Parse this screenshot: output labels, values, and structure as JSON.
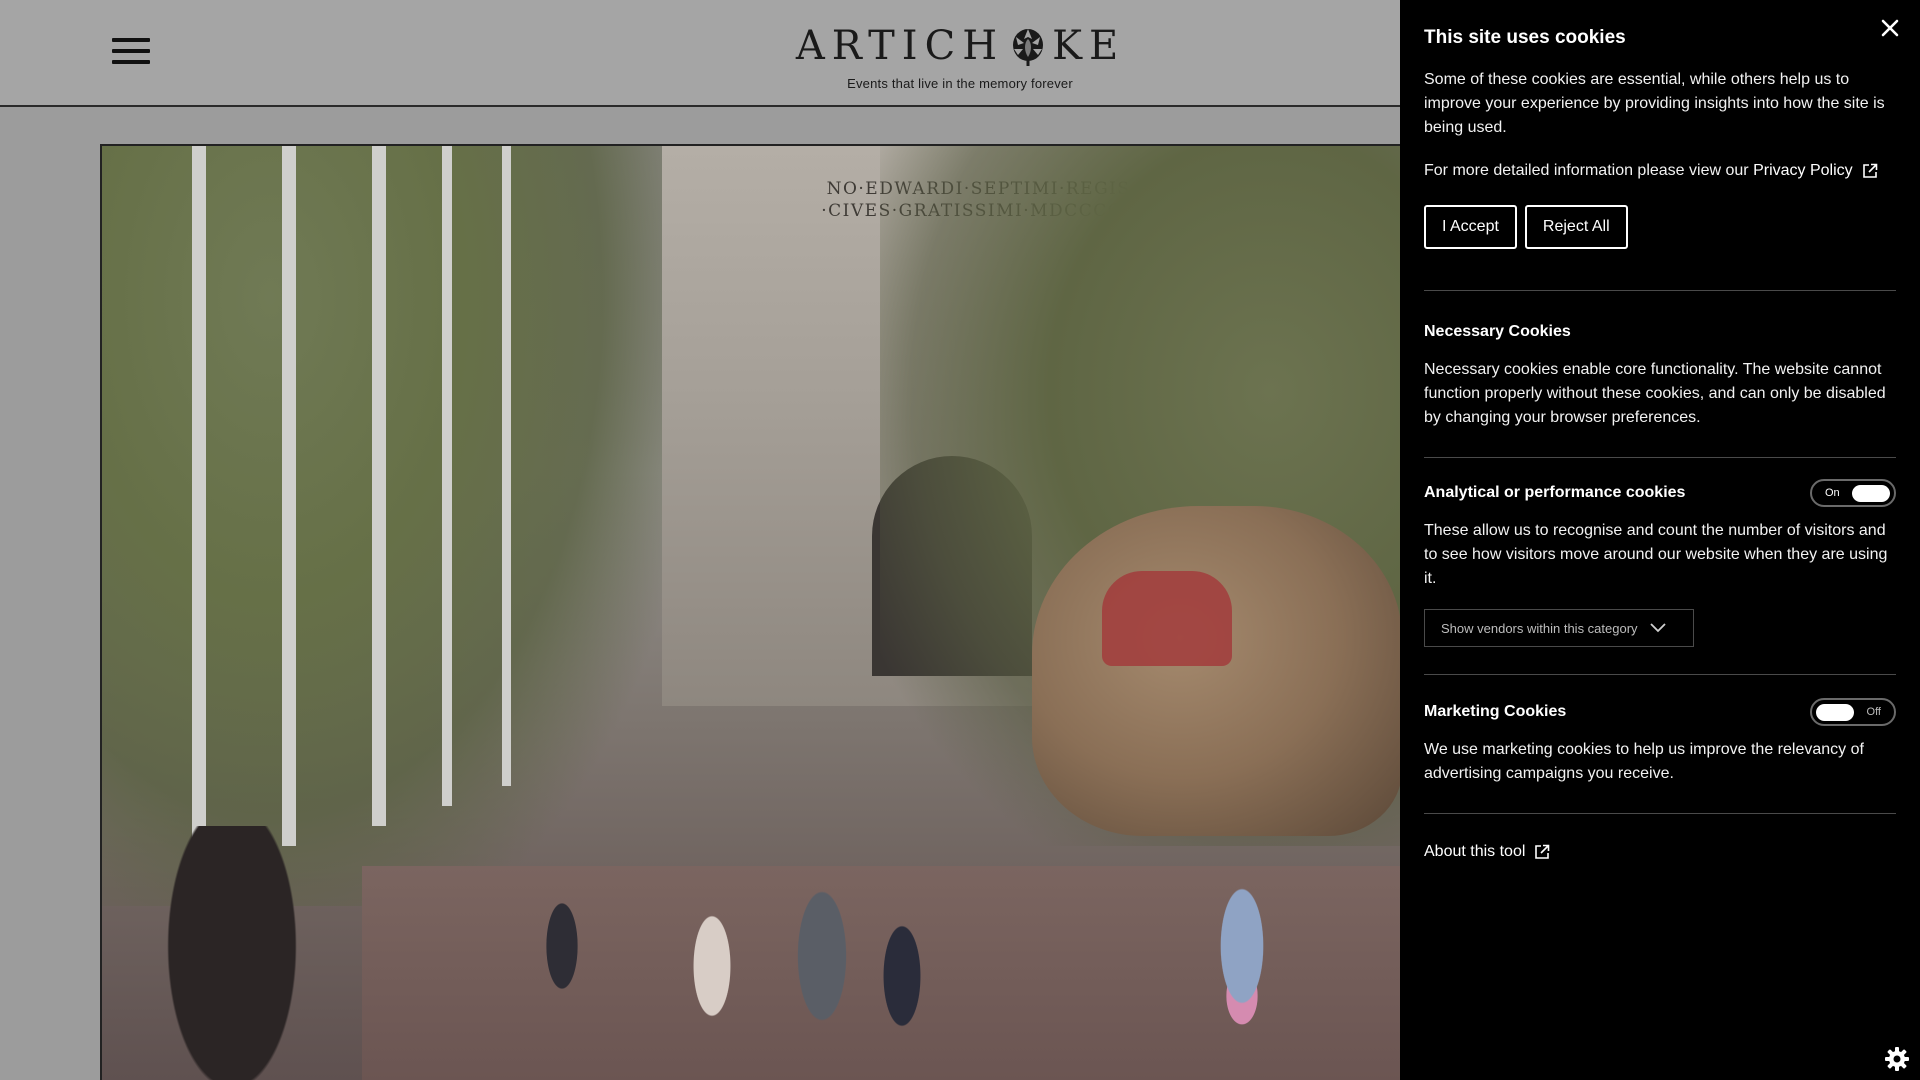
{
  "header": {
    "logo_left": "ARTICH",
    "logo_right": "KE",
    "tagline": "Events that live in the memory forever",
    "menu_icon": "hamburger-menu-icon"
  },
  "hero": {
    "inscription_line1": "NO·EDWARDI·SEPTIMI·REGIS·",
    "inscription_line2": "·CIVES·GRATISSIMI·MDCCCCX·"
  },
  "cookie_panel": {
    "title": "This site uses cookies",
    "intro": "Some of these cookies are essential, while others help us to improve your experience by providing insights into how the site is being used.",
    "policy_prefix": "For more detailed information please view our",
    "policy_link": "Privacy Policy",
    "accept_label": "I Accept",
    "reject_label": "Reject All",
    "sections": [
      {
        "title": "Necessary Cookies",
        "body": "Necessary cookies enable core functionality. The website cannot function properly without these cookies, and can only be disabled by changing your browser preferences."
      },
      {
        "title": "Analytical or performance cookies",
        "toggle": "On",
        "body": "These allow us to recognise and count the number of visitors and to see how visitors move around our website when they are using it.",
        "vendors_label": "Show vendors within this category"
      },
      {
        "title": "Marketing Cookies",
        "toggle": "Off",
        "body": "We use marketing cookies to help us improve the relevancy of advertising campaigns you receive."
      }
    ],
    "about_label": "About this tool"
  },
  "colors": {
    "panel_bg": "#000000",
    "panel_text": "#ffffff",
    "page_overlay": "#9c9c9c"
  }
}
